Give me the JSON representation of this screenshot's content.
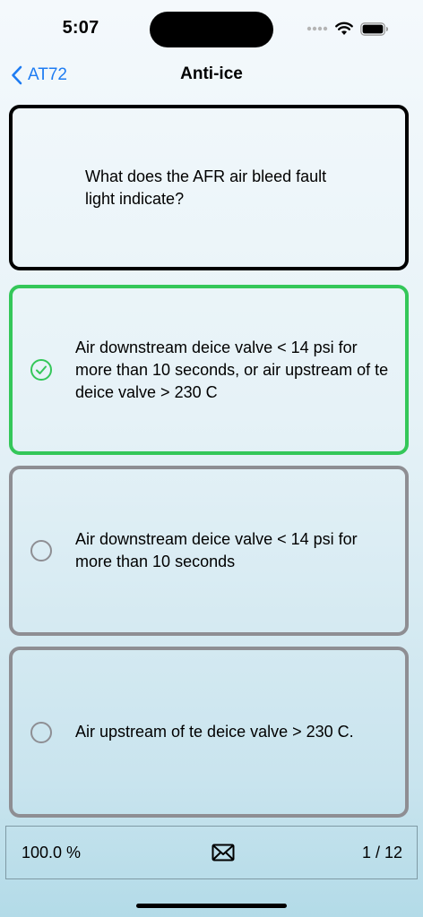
{
  "status_bar": {
    "time": "5:07",
    "icons": [
      "signal-dots-icon",
      "wifi-icon",
      "battery-icon"
    ]
  },
  "nav": {
    "back_label": "AT72",
    "title": "Anti-ice"
  },
  "question": {
    "text": "What does the AFR air bleed fault light indicate?"
  },
  "answers": [
    {
      "text": "Air downstream deice valve < 14 psi for more than 10 seconds, or air upstream of te deice valve > 230 C",
      "selected": true
    },
    {
      "text": "Air downstream deice valve < 14 psi for more than 10 seconds",
      "selected": false
    },
    {
      "text": "Air upstream of te deice valve > 230 C.",
      "selected": false
    }
  ],
  "footer": {
    "score": "100.0 %",
    "counter": "1 / 12",
    "mail_icon": "envelope-icon"
  },
  "colors": {
    "accent": "#1e7cf2",
    "correct": "#34c759",
    "neutral_border": "#8e8e93"
  }
}
